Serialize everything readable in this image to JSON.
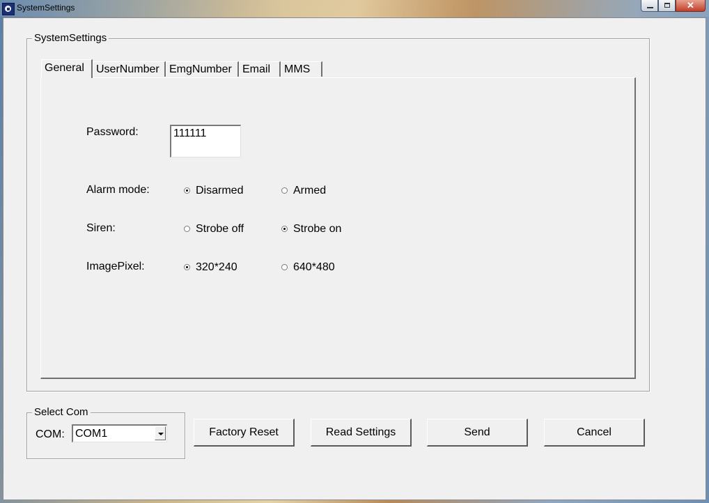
{
  "window": {
    "title": "SystemSettings",
    "close_glyph": "✕"
  },
  "settings_group": {
    "caption": "SystemSettings"
  },
  "tabs": [
    {
      "label": "General",
      "active": true
    },
    {
      "label": "UserNumber",
      "active": false
    },
    {
      "label": "EmgNumber",
      "active": false
    },
    {
      "label": "Email",
      "active": false
    },
    {
      "label": "MMS",
      "active": false
    }
  ],
  "general": {
    "password": {
      "label": "Password:",
      "value": "111111"
    },
    "alarm_mode": {
      "label": "Alarm mode:",
      "options": [
        "Disarmed",
        "Armed"
      ],
      "selected": "Disarmed"
    },
    "siren": {
      "label": "Siren:",
      "options": [
        "Strobe off",
        "Strobe on"
      ],
      "selected": "Strobe on"
    },
    "image_pixel": {
      "label": "ImagePixel:",
      "options": [
        "320*240",
        "640*480"
      ],
      "selected": "320*240"
    }
  },
  "com_group": {
    "caption": "Select Com",
    "label": "COM:",
    "value": "COM1"
  },
  "buttons": {
    "factory_reset": "Factory Reset",
    "read_settings": "Read Settings",
    "send": "Send",
    "cancel": "Cancel"
  }
}
